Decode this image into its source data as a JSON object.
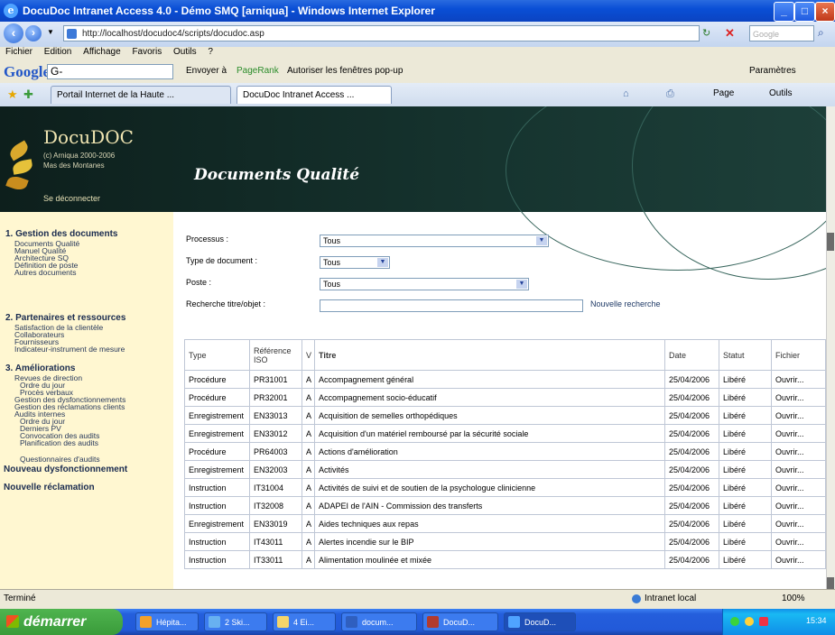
{
  "window": {
    "title": "DocuDoc Intranet Access 4.0 - Démo SMQ [arniqua] - Windows Internet Explorer"
  },
  "browser": {
    "url": "http://localhost/docudoc4/scripts/docudoc.asp",
    "search_placeholder": "Google",
    "menu": [
      "Fichier",
      "Edition",
      "Affichage",
      "Favoris",
      "Outils",
      "?"
    ],
    "google_toolbar": {
      "logo": "Google",
      "input": "G-",
      "send": "Envoyer à",
      "pagerank": "PageRank",
      "popups": "Autoriser les fenêtres pop-up",
      "settings": "Paramètres"
    },
    "tabs": [
      "Portail Internet de la Haute ...",
      "DocuDoc Intranet Access ..."
    ],
    "page_tools": [
      "Page",
      "Outils"
    ]
  },
  "app": {
    "logo": "DocuDOC",
    "copyright": "(c) Arniqua 2000-2006",
    "org": "Mas des Montanes",
    "disconnect": "Se déconnecter",
    "page_title": "Documents Qualité"
  },
  "sidebar": {
    "section1": {
      "title": "1. Gestion des documents",
      "items": [
        "Documents Qualité",
        "Manuel Qualité",
        "Architecture SQ",
        "Définition de poste",
        "Autres documents"
      ]
    },
    "section2": {
      "title": "2. Partenaires et ressources",
      "items": [
        "Satisfaction de la clientèle",
        "Collaborateurs",
        "Fournisseurs",
        "Indicateur-instrument de mesure"
      ]
    },
    "section3": {
      "title": "3. Améliorations",
      "items": [
        "Revues de direction",
        "Ordre du jour",
        "Procès verbaux",
        "Gestion des dysfonctionnements",
        "Gestion des réclamations clients",
        "Audits internes",
        "Ordre du jour",
        "Derniers PV",
        "Convocation des audits",
        "Planification des audits",
        "Questionnaires d'audits"
      ]
    },
    "new_dysfunction": "Nouveau dysfonctionnement",
    "new_claim": "Nouvelle réclamation"
  },
  "filters": {
    "processus_label": "Processus :",
    "processus_value": "Tous",
    "type_label": "Type de document :",
    "type_value": "Tous",
    "poste_label": "Poste :",
    "poste_value": "Tous",
    "search_label": "Recherche titre/objet :",
    "new_search": "Nouvelle recherche"
  },
  "table": {
    "headers": {
      "type": "Type",
      "ref": "Référence ISO",
      "v": "V",
      "titre": "Titre",
      "date": "Date",
      "statut": "Statut",
      "fichier": "Fichier"
    },
    "rows": [
      {
        "type": "Procédure",
        "ref": "PR31001",
        "v": "A",
        "titre": "Accompagnement général",
        "date": "25/04/2006",
        "statut": "Libéré",
        "fichier": "Ouvrir..."
      },
      {
        "type": "Procédure",
        "ref": "PR32001",
        "v": "A",
        "titre": "Accompagnement socio-éducatif",
        "date": "25/04/2006",
        "statut": "Libéré",
        "fichier": "Ouvrir..."
      },
      {
        "type": "Enregistrement",
        "ref": "EN33013",
        "v": "A",
        "titre": "Acquisition de semelles orthopédiques",
        "date": "25/04/2006",
        "statut": "Libéré",
        "fichier": "Ouvrir..."
      },
      {
        "type": "Enregistrement",
        "ref": "EN33012",
        "v": "A",
        "titre": "Acquisition d'un matériel remboursé par la sécurité sociale",
        "date": "25/04/2006",
        "statut": "Libéré",
        "fichier": "Ouvrir..."
      },
      {
        "type": "Procédure",
        "ref": "PR64003",
        "v": "A",
        "titre": "Actions d'amélioration",
        "date": "25/04/2006",
        "statut": "Libéré",
        "fichier": "Ouvrir..."
      },
      {
        "type": "Enregistrement",
        "ref": "EN32003",
        "v": "A",
        "titre": "Activités",
        "date": "25/04/2006",
        "statut": "Libéré",
        "fichier": "Ouvrir..."
      },
      {
        "type": "Instruction",
        "ref": "IT31004",
        "v": "A",
        "titre": "Activités de suivi et de soutien de la psychologue clinicienne",
        "date": "25/04/2006",
        "statut": "Libéré",
        "fichier": "Ouvrir..."
      },
      {
        "type": "Instruction",
        "ref": "IT32008",
        "v": "A",
        "titre": "ADAPEI de l'AIN - Commission des transferts",
        "date": "25/04/2006",
        "statut": "Libéré",
        "fichier": "Ouvrir..."
      },
      {
        "type": "Enregistrement",
        "ref": "EN33019",
        "v": "A",
        "titre": "Aides techniques aux repas",
        "date": "25/04/2006",
        "statut": "Libéré",
        "fichier": "Ouvrir..."
      },
      {
        "type": "Instruction",
        "ref": "IT43011",
        "v": "A",
        "titre": "Alertes incendie sur le BIP",
        "date": "25/04/2006",
        "statut": "Libéré",
        "fichier": "Ouvrir..."
      },
      {
        "type": "Instruction",
        "ref": "IT33011",
        "v": "A",
        "titre": "Alimentation moulinée et mixée",
        "date": "25/04/2006",
        "statut": "Libéré",
        "fichier": "Ouvrir..."
      }
    ]
  },
  "statusbar": {
    "left": "Terminé",
    "zone": "Intranet local",
    "zoom": "100%"
  },
  "taskbar": {
    "start": "démarrer",
    "tasks": [
      "Hépita...",
      "2 Ski...",
      "4 Ei...",
      "docum...",
      "DocuD...",
      "DocuD..."
    ],
    "clock": "15:34"
  }
}
